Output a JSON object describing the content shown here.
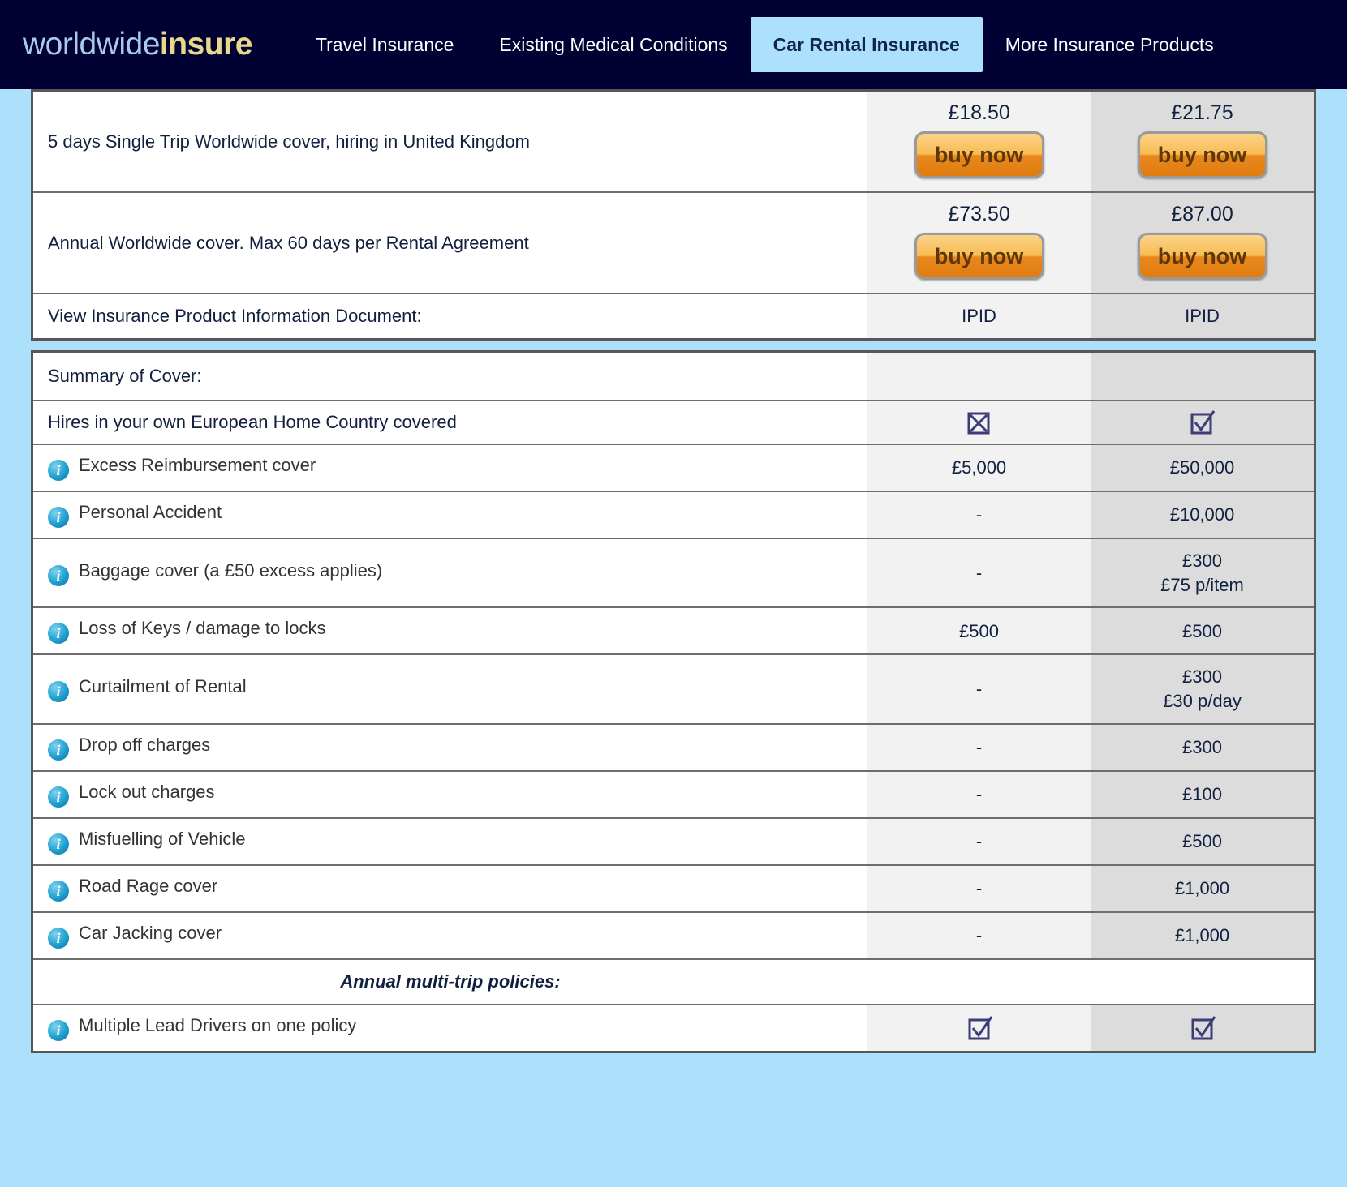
{
  "header": {
    "logo_part1": "worldwide",
    "logo_part2": "insure",
    "nav": [
      {
        "label": "Travel Insurance",
        "active": false
      },
      {
        "label": "Existing Medical Conditions",
        "active": false
      },
      {
        "label": "Car Rental Insurance",
        "active": true
      },
      {
        "label": "More Insurance Products",
        "active": false
      }
    ],
    "accent_navy": "#000033",
    "accent_lightblue": "#ade0fa"
  },
  "pricing": {
    "rows": [
      {
        "description": "5 days Single Trip Worldwide cover, hiring in United Kingdom",
        "price_a": "£18.50",
        "price_b": "£21.75",
        "buy_label": "buy now"
      },
      {
        "description": "Annual Worldwide cover. Max 60 days per Rental Agreement",
        "price_a": "£73.50",
        "price_b": "£87.00",
        "buy_label": "buy now"
      }
    ],
    "ipid_label": "View Insurance Product Information Document:",
    "ipid_a": "IPID",
    "ipid_b": "IPID"
  },
  "summary": {
    "heading": "Summary of Cover:",
    "multitrip_heading": "Annual multi-trip policies:",
    "rows": [
      {
        "label": "Hires in your own European Home Country covered",
        "has_info": false,
        "type": "icon",
        "value_a": "cross-checkbox-icon",
        "value_b": "tick-checkbox-icon"
      },
      {
        "label": "Excess Reimbursement cover",
        "has_info": true,
        "type": "text",
        "value_a": "£5,000",
        "value_b": "£50,000"
      },
      {
        "label": "Personal Accident",
        "has_info": true,
        "type": "text",
        "value_a": "-",
        "value_b": "£10,000"
      },
      {
        "label": "Baggage cover (a £50 excess applies)",
        "has_info": true,
        "type": "text",
        "value_a": "-",
        "value_b": "£300",
        "value_b_line2": "£75 p/item"
      },
      {
        "label": "Loss of Keys / damage to locks",
        "has_info": true,
        "type": "text",
        "value_a": "£500",
        "value_b": "£500"
      },
      {
        "label": "Curtailment of Rental",
        "has_info": true,
        "type": "text",
        "value_a": "-",
        "value_b": "£300",
        "value_b_line2": "£30 p/day"
      },
      {
        "label": "Drop off charges",
        "has_info": true,
        "type": "text",
        "value_a": "-",
        "value_b": "£300"
      },
      {
        "label": "Lock out charges",
        "has_info": true,
        "type": "text",
        "value_a": "-",
        "value_b": "£100"
      },
      {
        "label": "Misfuelling of Vehicle",
        "has_info": true,
        "type": "text",
        "value_a": "-",
        "value_b": "£500"
      },
      {
        "label": "Road Rage cover",
        "has_info": true,
        "type": "text",
        "value_a": "-",
        "value_b": "£1,000"
      },
      {
        "label": "Car Jacking cover",
        "has_info": true,
        "type": "text",
        "value_a": "-",
        "value_b": "£1,000"
      }
    ],
    "multitrip_rows": [
      {
        "label": "Multiple Lead Drivers on one policy",
        "has_info": true,
        "type": "icon",
        "value_a": "tick-checkbox-icon",
        "value_b": "tick-checkbox-icon"
      }
    ],
    "info_icon_glyph": "i"
  }
}
